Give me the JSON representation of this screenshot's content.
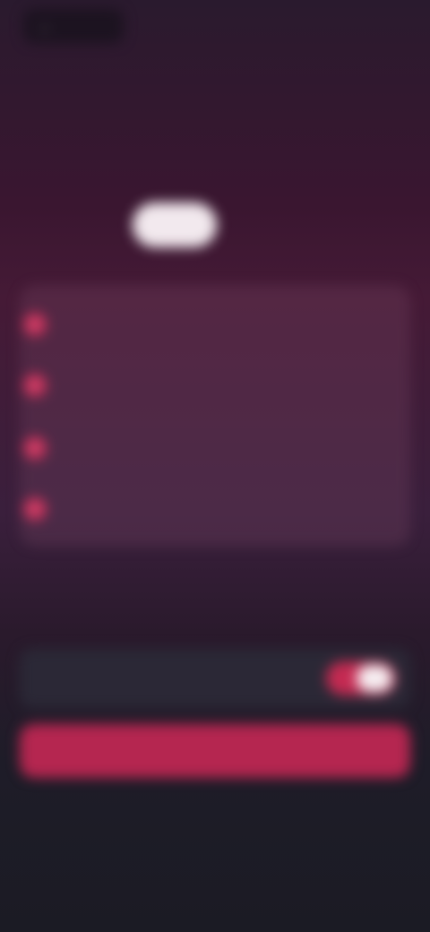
{
  "topbar": {
    "back_icon": "←",
    "back_label": "",
    "restore_label": ""
  },
  "banner": {
    "text": ""
  },
  "hero": {
    "title": "",
    "subtitle": "",
    "price_badge": "",
    "price_note": ""
  },
  "features": [
    {
      "icon": "check-icon",
      "glyph": "✓",
      "label": ""
    },
    {
      "icon": "check-icon",
      "glyph": "✓",
      "label": ""
    },
    {
      "icon": "check-icon",
      "glyph": "✓",
      "label": ""
    },
    {
      "icon": "check-icon",
      "glyph": "✓",
      "label": ""
    }
  ],
  "trial": {
    "label": "",
    "enabled": true
  },
  "cta": {
    "label": ""
  },
  "footer": {
    "cancel_note": "",
    "left_link": "",
    "right_link": ""
  },
  "colors": {
    "accent": "#c42a52",
    "cta": "#b52650",
    "background_top": "#2a1a2e",
    "background_bottom": "#1b1b24"
  }
}
